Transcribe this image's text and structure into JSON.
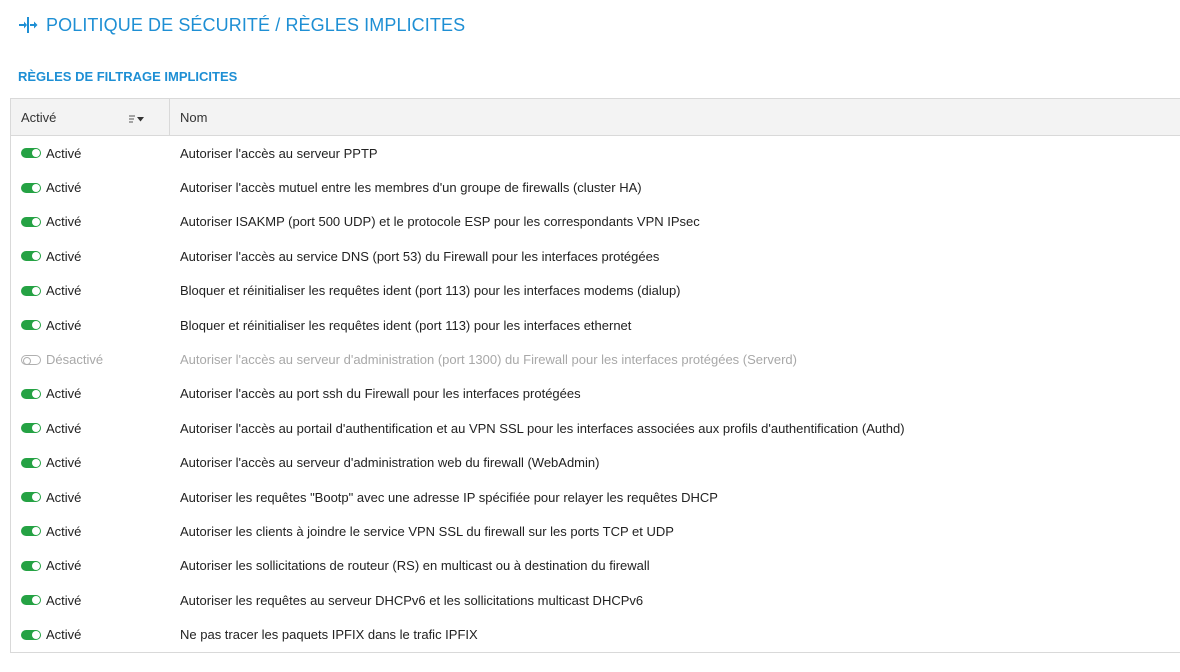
{
  "header": {
    "title": "POLITIQUE DE SÉCURITÉ / RÈGLES IMPLICITES",
    "icon": "policy-icon"
  },
  "section": {
    "title": "RÈGLES DE FILTRAGE IMPLICITES"
  },
  "grid": {
    "columns": {
      "active": "Activé",
      "name": "Nom"
    },
    "rows": [
      {
        "enabled": true,
        "status": "Activé",
        "name": "Autoriser l'accès au serveur PPTP"
      },
      {
        "enabled": true,
        "status": "Activé",
        "name": "Autoriser l'accès mutuel entre les membres d'un groupe de firewalls (cluster HA)"
      },
      {
        "enabled": true,
        "status": "Activé",
        "name": "Autoriser ISAKMP (port 500 UDP) et le protocole ESP pour les correspondants VPN IPsec"
      },
      {
        "enabled": true,
        "status": "Activé",
        "name": "Autoriser l'accès au service DNS (port 53) du Firewall pour les interfaces protégées"
      },
      {
        "enabled": true,
        "status": "Activé",
        "name": "Bloquer et réinitialiser les requêtes ident (port 113) pour les interfaces modems (dialup)"
      },
      {
        "enabled": true,
        "status": "Activé",
        "name": "Bloquer et réinitialiser les requêtes ident (port 113) pour les interfaces ethernet"
      },
      {
        "enabled": false,
        "status": "Désactivé",
        "name": "Autoriser l'accès au serveur d'administration (port 1300) du Firewall pour les interfaces protégées (Serverd)"
      },
      {
        "enabled": true,
        "status": "Activé",
        "name": "Autoriser l'accès au port ssh du Firewall pour les interfaces protégées"
      },
      {
        "enabled": true,
        "status": "Activé",
        "name": "Autoriser l'accès au portail d'authentification et au VPN SSL pour les interfaces associées aux profils d'authentification (Authd)"
      },
      {
        "enabled": true,
        "status": "Activé",
        "name": "Autoriser l'accès au serveur d'administration web du firewall (WebAdmin)"
      },
      {
        "enabled": true,
        "status": "Activé",
        "name": "Autoriser les requêtes \"Bootp\" avec une adresse IP spécifiée pour relayer les requêtes DHCP"
      },
      {
        "enabled": true,
        "status": "Activé",
        "name": "Autoriser les clients à joindre le service VPN SSL du firewall sur les ports TCP et UDP"
      },
      {
        "enabled": true,
        "status": "Activé",
        "name": "Autoriser les sollicitations de routeur (RS) en multicast ou à destination du firewall"
      },
      {
        "enabled": true,
        "status": "Activé",
        "name": "Autoriser les requêtes au serveur DHCPv6 et les sollicitations multicast DHCPv6"
      },
      {
        "enabled": true,
        "status": "Activé",
        "name": "Ne pas tracer les paquets IPFIX dans le trafic IPFIX"
      }
    ]
  },
  "colors": {
    "accent": "#1e8fd4",
    "toggle_on": "#25a244",
    "disabled_text": "#a8a8a8"
  }
}
